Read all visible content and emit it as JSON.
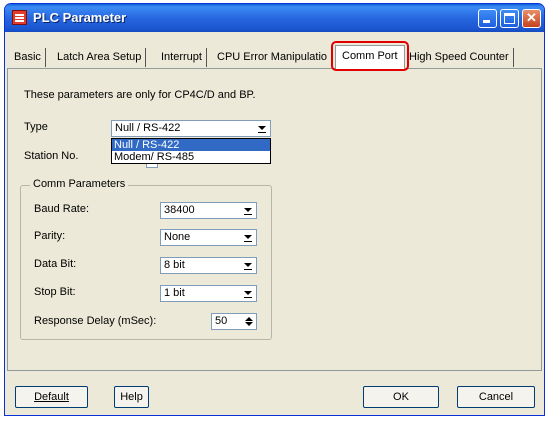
{
  "window": {
    "title": "PLC Parameter"
  },
  "tabs": [
    {
      "label": "Basic"
    },
    {
      "label": "Latch Area Setup"
    },
    {
      "label": "Interrupt"
    },
    {
      "label": "CPU Error Manipulatio"
    },
    {
      "label": "Comm Port"
    },
    {
      "label": "High Speed Counter"
    }
  ],
  "panel": {
    "note": "These parameters are only for CP4C/D and BP.",
    "type_label": "Type",
    "type_value": "Null / RS-422",
    "type_options": [
      "Null / RS-422",
      "Modem/ RS-485"
    ],
    "station_label": "Station No.",
    "group_title": "Comm Parameters",
    "baud_label": "Baud Rate:",
    "baud_value": "38400",
    "parity_label": "Parity:",
    "parity_value": "None",
    "databit_label": "Data Bit:",
    "databit_value": "8 bit",
    "stopbit_label": "Stop Bit:",
    "stopbit_value": "1 bit",
    "delay_label": "Response Delay (mSec):",
    "delay_value": "50"
  },
  "buttons": {
    "default": "Default",
    "help": "Help",
    "ok": "OK",
    "cancel": "Cancel"
  },
  "colors": {
    "titlebar": "#2767e0",
    "highlight": "#e00000",
    "selection": "#316ac5"
  }
}
